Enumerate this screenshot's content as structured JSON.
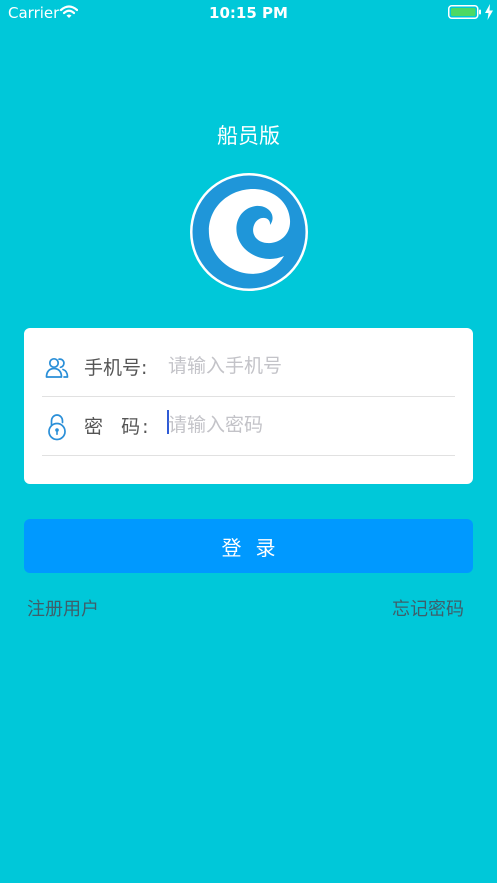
{
  "status_bar": {
    "carrier": "Carrier",
    "time": "10:15 PM",
    "battery_color": "#4cd964"
  },
  "app": {
    "title": "船员版",
    "logo_color": "#1f96d9"
  },
  "form": {
    "phone_label": "手机号:",
    "phone_placeholder": "请输入手机号",
    "phone_value": "",
    "phone_icon": "users-icon",
    "password_label": "密  码:",
    "password_placeholder": "请输入密码",
    "password_value": "",
    "password_icon": "lock-icon"
  },
  "actions": {
    "login_label": "登录",
    "register_label": "注册用户",
    "forgot_label": "忘记密码"
  },
  "colors": {
    "background": "#00c8d9",
    "primary_button": "#0099ff",
    "icon_blue": "#2a8fd8"
  }
}
